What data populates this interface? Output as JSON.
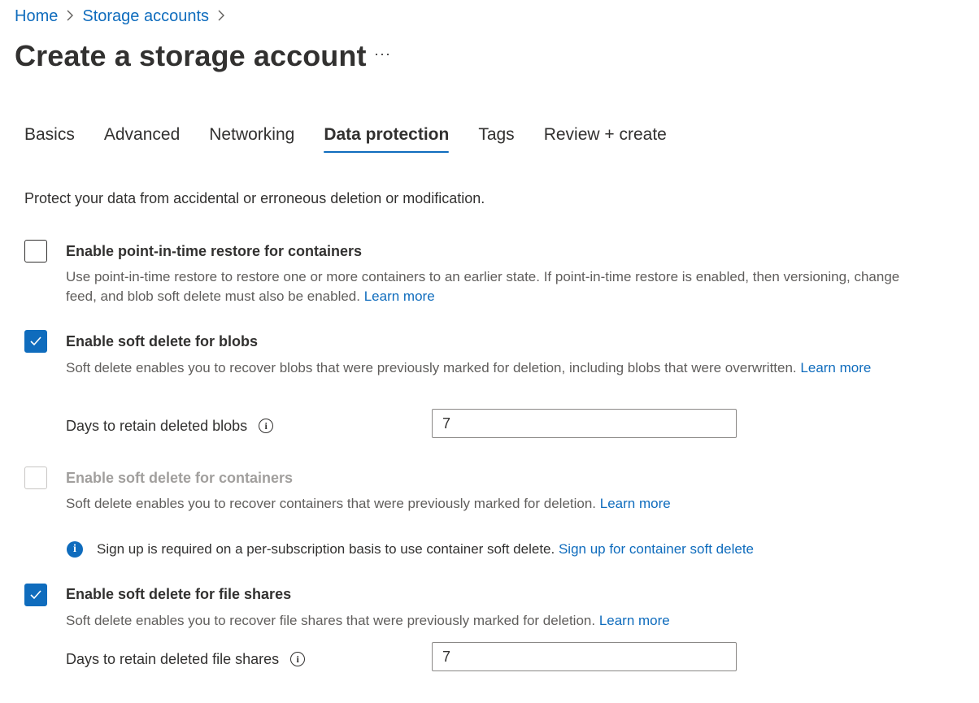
{
  "breadcrumb": {
    "home": "Home",
    "storage_accounts": "Storage accounts"
  },
  "page": {
    "title": "Create a storage account",
    "more": "···"
  },
  "tabs": [
    {
      "label": "Basics",
      "active": false
    },
    {
      "label": "Advanced",
      "active": false
    },
    {
      "label": "Networking",
      "active": false
    },
    {
      "label": "Data protection",
      "active": true
    },
    {
      "label": "Tags",
      "active": false
    },
    {
      "label": "Review + create",
      "active": false
    }
  ],
  "intro": "Protect your data from accidental or erroneous deletion or modification.",
  "options": {
    "pitr": {
      "title": "Enable point-in-time restore for containers",
      "checked": false,
      "desc": "Use point-in-time restore to restore one or more containers to an earlier state. If point-in-time restore is enabled, then versioning, change feed, and blob soft delete must also be enabled.",
      "link": "Learn more"
    },
    "blob_soft_delete": {
      "title": "Enable soft delete for blobs",
      "checked": true,
      "desc": "Soft delete enables you to recover blobs that were previously marked for deletion, including blobs that were overwritten.",
      "link": "Learn more",
      "field_label": "Days to retain deleted blobs",
      "field_value": "7"
    },
    "container_soft_delete": {
      "title": "Enable soft delete for containers",
      "checked": false,
      "disabled": true,
      "desc": "Soft delete enables you to recover containers that were previously marked for deletion.",
      "link": "Learn more",
      "notice": "Sign up is required on a per-subscription basis to use container soft delete.",
      "notice_link": "Sign up for container soft delete"
    },
    "file_share_soft_delete": {
      "title": "Enable soft delete for file shares",
      "checked": true,
      "desc": "Soft delete enables you to recover file shares that were previously marked for deletion.",
      "link": "Learn more",
      "field_label": "Days to retain deleted file shares",
      "field_value": "7"
    }
  },
  "colors": {
    "accent": "#0f6cbd",
    "text": "#323130",
    "secondary": "#605e5c",
    "disabled": "#a19f9d"
  },
  "icons": {
    "breadcrumb_sep": "chevron-right-icon",
    "check": "checkmark-icon",
    "info": "info-icon"
  }
}
